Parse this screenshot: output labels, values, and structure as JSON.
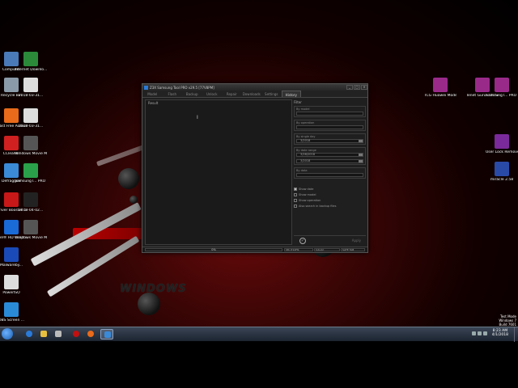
{
  "app": {
    "title": "Z3X Samsung Tool PRO v29.5 [77V8PM]",
    "tabs": [
      "Model",
      "Flash",
      "Backup",
      "Unlock",
      "Repair",
      "Downloads",
      "Settings",
      "History"
    ],
    "active_tab": "History",
    "result_label": "Result",
    "filter": {
      "title": "Filter",
      "by_model": "By model",
      "by_operation": "By operation",
      "by_single_day": "By single day",
      "single_day": "3/2018",
      "by_date_range": "By date range",
      "date_from": "3/26/2018",
      "date_to": "3/2018",
      "by_data": "By data",
      "show_date": "Show date",
      "show_model": "Show model",
      "show_operation": "Show operation",
      "also_search": "Also search in backup files",
      "apply": "Apply"
    },
    "progress_text": "0%",
    "status": [
      "SM-J710FN",
      "[stock]",
      "SAFE TAB"
    ]
  },
  "desktop": {
    "left_icons": [
      {
        "label": "Computer",
        "color": "#4a7ab8"
      },
      {
        "label": "Internet Downlo...",
        "color": "#2a8a3a"
      },
      {
        "label": "Recycle Bin",
        "color": "#8a9aa8"
      },
      {
        "label": "2018-03-31...",
        "color": "#ddd"
      },
      {
        "label": "Avast Free Antivirus",
        "color": "#e86a1a"
      },
      {
        "label": "2018-03-31...",
        "color": "#ddd"
      },
      {
        "label": "CCleaner",
        "color": "#d02020"
      },
      {
        "label": "Windows Movie Maker",
        "color": "#555"
      },
      {
        "label": "Defraggler",
        "color": "#3a8ad8"
      },
      {
        "label": "SamsungT... PRO 29.5 B...",
        "color": "#2aa04a"
      },
      {
        "label": "Driver Booster 5",
        "color": "#c81818"
      },
      {
        "label": "2018-04-02...",
        "color": "#222"
      },
      {
        "label": "Intel® HD Graphics C...",
        "color": "#1a6ad8"
      },
      {
        "label": "Windows Movie Maker",
        "color": "#555"
      },
      {
        "label": "Malwareby...",
        "color": "#1a4ab8"
      },
      {
        "label": "PowerISO",
        "color": "#ddd"
      },
      {
        "label": "OBS Screen ...",
        "color": "#2a8ad8"
      }
    ],
    "right_icons": [
      {
        "label": "TCG Huawei Modem U...",
        "color": "#9a2a8a"
      },
      {
        "label": "Tenet Gurus Llc Service ...",
        "color": "#9a2a8a"
      },
      {
        "label": "SamsungT... PRO 29.5 B...",
        "color": "#9a2a8a"
      },
      {
        "label": "User Lock Remove",
        "color": "#7a2a9a"
      },
      {
        "label": "miracle 2.58",
        "color": "#2a4aa8"
      }
    ],
    "wallpaper_text": "WINDOWS"
  },
  "taskbar": {
    "time": "8:23 AM",
    "date": "4/1/2018"
  },
  "watermark": [
    "Test Mode",
    "Windows 7",
    "Build 7601"
  ]
}
